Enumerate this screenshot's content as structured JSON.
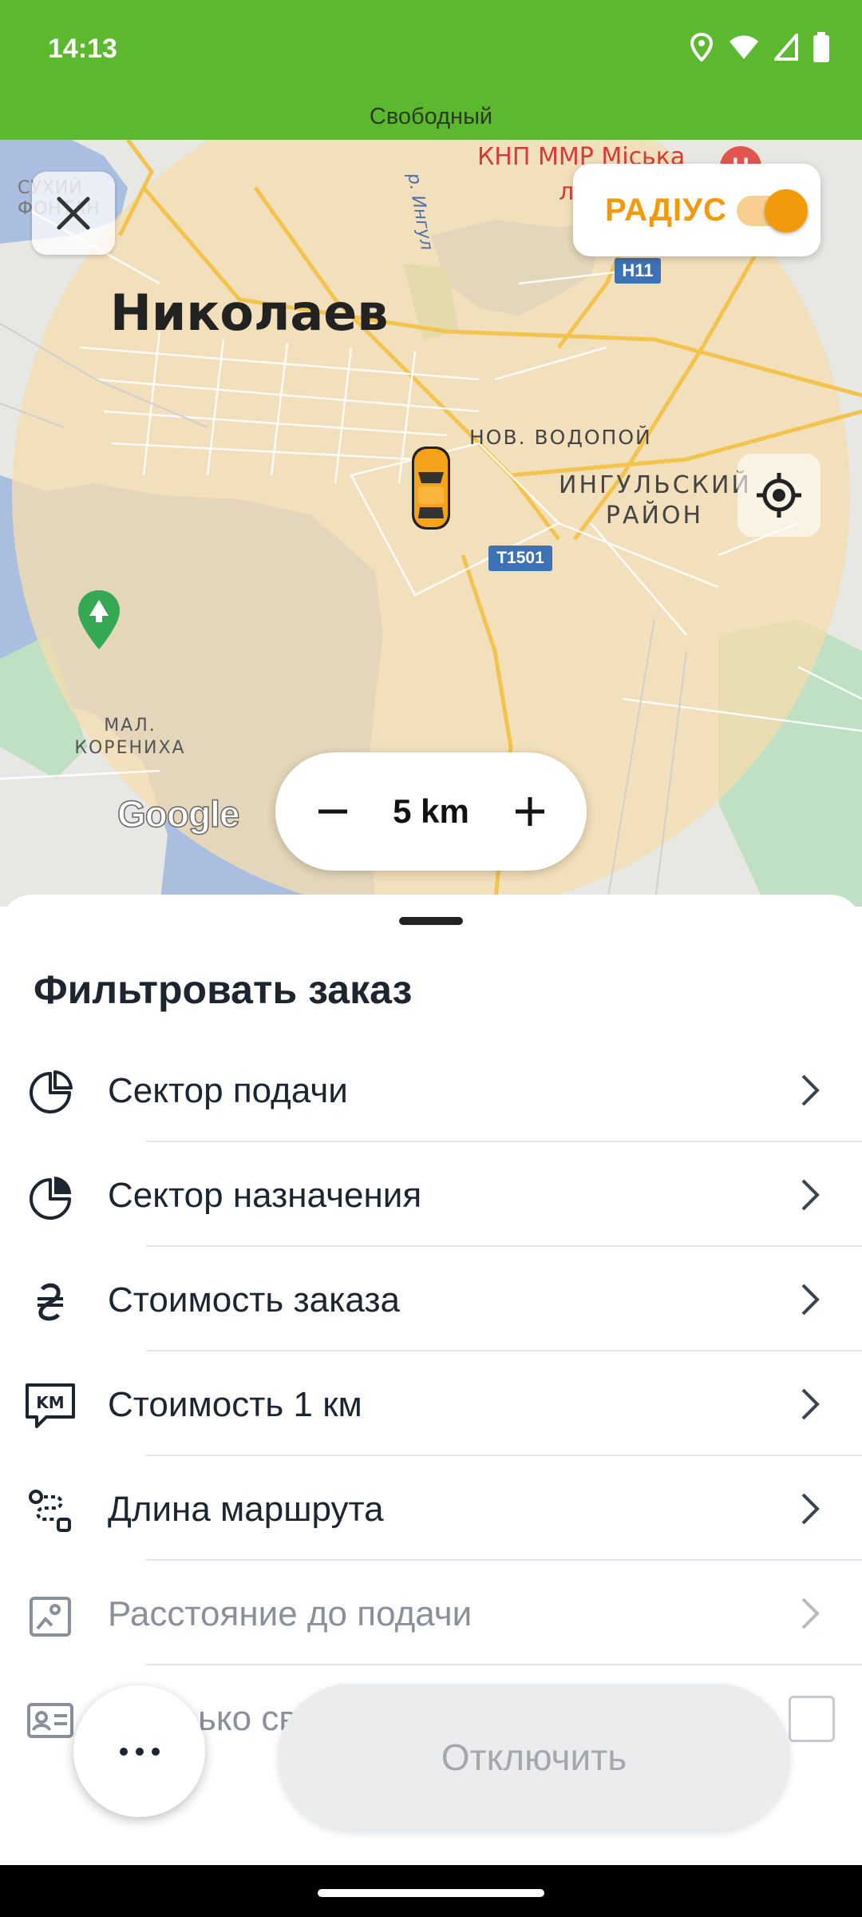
{
  "status_bar": {
    "time": "14:13",
    "subtitle": "Свободный"
  },
  "map": {
    "city_label": "Николаев",
    "district_label_1": "ИНГУЛЬСКИЙ",
    "district_label_2": "РАЙОН",
    "neighborhood_label": "НОВ. ВОДОПОЙ",
    "area_label_1": "МАЛ.",
    "area_label_2": "КОРЕНИХА",
    "top_left_label_1": "СУХИЙ",
    "top_left_label_2": "ФОНТАН",
    "poi_label": "КНП ММР Міська",
    "poi_label_2": "л",
    "river_label": "р. Ингул",
    "road_h11": "H11",
    "road_t1501": "T1501",
    "google_logo": "Google"
  },
  "radius": {
    "label": "РАДІУС",
    "enabled": true
  },
  "zoom": {
    "value": "5 km"
  },
  "sheet": {
    "title": "Фильтровать заказ",
    "items": [
      {
        "label": "Сектор подачи",
        "icon": "pie-sector-icon",
        "enabled": true
      },
      {
        "label": "Сектор назначения",
        "icon": "pie-filled-icon",
        "enabled": true
      },
      {
        "label": "Стоимость заказа",
        "icon": "hryvnia-icon",
        "enabled": true
      },
      {
        "label": "Стоимость 1 км",
        "icon": "km-chat-icon",
        "enabled": true
      },
      {
        "label": "Длина маршрута",
        "icon": "route-icon",
        "enabled": true
      },
      {
        "label": "Расстояние до подачи",
        "icon": "map-pin-card-icon",
        "enabled": false
      },
      {
        "label": "ько сво",
        "icon": "id-card-icon",
        "enabled": false
      }
    ]
  },
  "actions": {
    "more": "more-icon",
    "disable_label": "Отключить"
  },
  "colors": {
    "status_green": "#5cb82e",
    "accent_orange": "#f39a0c",
    "radius_fill": "#f5ddb0"
  }
}
